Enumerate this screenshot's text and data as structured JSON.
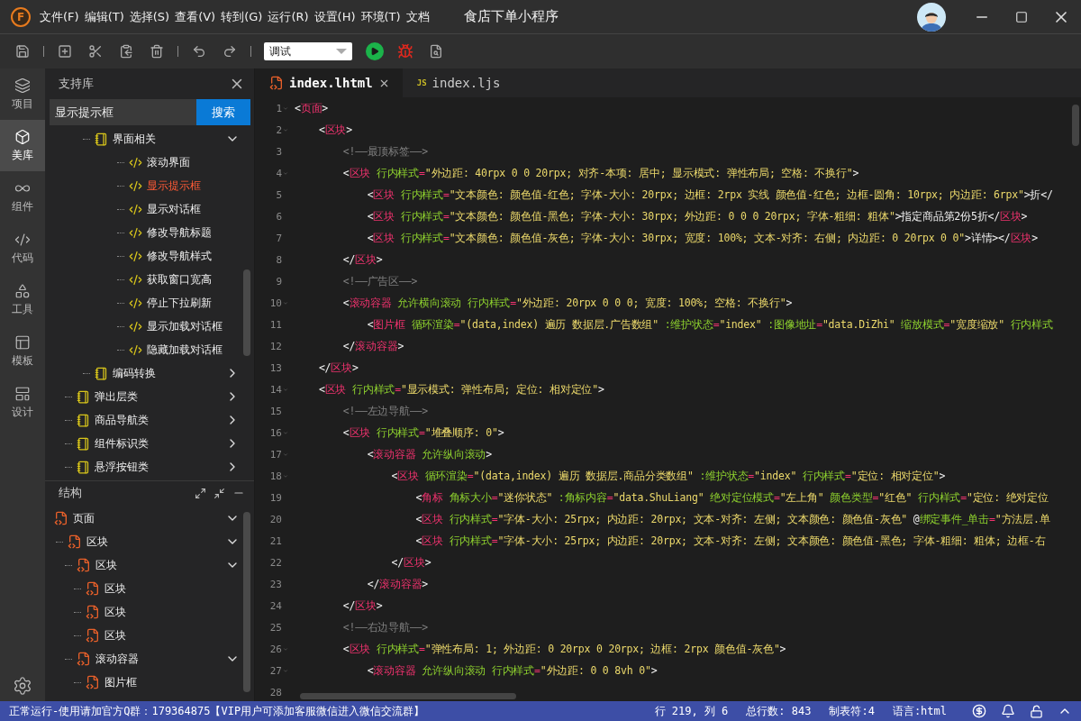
{
  "app": {
    "logo_letter": "F",
    "menu": [
      "文件(F)",
      "编辑(T)",
      "选择(S)",
      "查看(V)",
      "转到(G)",
      "运行(R)",
      "设置(H)",
      "环境(T)",
      "文档"
    ],
    "title": "食店下单小程序"
  },
  "toolbar": {
    "mode_select": {
      "value": "调试"
    }
  },
  "activity_bar": [
    {
      "label": "项目",
      "kind": "layers",
      "selected": false
    },
    {
      "label": "美库",
      "kind": "box",
      "selected": true
    },
    {
      "label": "组件",
      "kind": "links",
      "selected": false
    },
    {
      "label": "代码",
      "kind": "code",
      "selected": false
    },
    {
      "label": "工具",
      "kind": "tools",
      "selected": false
    },
    {
      "label": "模板",
      "kind": "template",
      "selected": false
    },
    {
      "label": "设计",
      "kind": "design",
      "selected": false
    }
  ],
  "library": {
    "title": "支持库",
    "search": {
      "value": "显示提示框"
    },
    "search_button": "搜索",
    "items": [
      {
        "kind": "group",
        "children": [
          {
            "label": "界面相关",
            "kind": "category",
            "expanded": true,
            "children": [
              {
                "label": "滚动界面",
                "kind": "snippet",
                "selected": false
              },
              {
                "label": "显示提示框",
                "kind": "snippet",
                "selected": true
              },
              {
                "label": "显示对话框",
                "kind": "snippet",
                "selected": false
              },
              {
                "label": "修改导航标题",
                "kind": "snippet",
                "selected": false
              },
              {
                "label": "修改导航样式",
                "kind": "snippet",
                "selected": false
              },
              {
                "label": "获取窗口宽高",
                "kind": "snippet",
                "selected": false
              },
              {
                "label": "停止下拉刷新",
                "kind": "snippet",
                "selected": false
              },
              {
                "label": "显示加载对话框",
                "kind": "snippet",
                "selected": false
              },
              {
                "label": "隐藏加载对话框",
                "kind": "snippet",
                "selected": false
              }
            ]
          },
          {
            "label": "编码转换",
            "kind": "category",
            "expanded": false
          }
        ]
      },
      {
        "label": "弹出层类",
        "kind": "category",
        "expanded": false
      },
      {
        "label": "商品导航类",
        "kind": "category",
        "expanded": false
      },
      {
        "label": "组件标识类",
        "kind": "category",
        "expanded": false
      },
      {
        "label": "悬浮按钮类",
        "kind": "category",
        "expanded": false
      }
    ]
  },
  "structure": {
    "title": "结构",
    "items": [
      {
        "label": "页面",
        "expanded": true,
        "children": [
          {
            "label": "区块",
            "expanded": true,
            "children": [
              {
                "label": "区块",
                "expanded": true,
                "children": [
                  {
                    "label": "区块"
                  },
                  {
                    "label": "区块"
                  },
                  {
                    "label": "区块"
                  }
                ]
              },
              {
                "label": "滚动容器",
                "expanded": true,
                "children": [
                  {
                    "label": "图片框"
                  }
                ]
              }
            ]
          }
        ]
      }
    ]
  },
  "editor": {
    "tabs": [
      {
        "label": "index.lhtml",
        "kind": "html",
        "selected": true
      },
      {
        "label": "index.ljs",
        "kind": "js",
        "badge": "JS",
        "selected": false
      }
    ],
    "lines": [
      {
        "number": "1",
        "foldable": true,
        "tokens": [
          {
            "kind": "punct",
            "text": "<"
          },
          {
            "kind": "tag",
            "text": "页面"
          },
          {
            "kind": "punct",
            "text": ">"
          }
        ]
      },
      {
        "number": "2",
        "foldable": true,
        "tokens": [
          {
            "kind": "punct",
            "text": "    <"
          },
          {
            "kind": "tag",
            "text": "区块"
          },
          {
            "kind": "punct",
            "text": ">"
          }
        ]
      },
      {
        "number": "3",
        "foldable": false,
        "tokens": [
          {
            "kind": "comment",
            "text": "        <!——最顶标签——>"
          }
        ]
      },
      {
        "number": "4",
        "foldable": true,
        "tokens": [
          {
            "kind": "punct",
            "text": "        <"
          },
          {
            "kind": "tag",
            "text": "区块"
          },
          {
            "kind": "attr",
            "text": " 行内样式"
          },
          {
            "kind": "op",
            "text": "="
          },
          {
            "kind": "string",
            "text": "\"外边距: 40rpx 0 0 20rpx; 对齐-本项: 居中; 显示模式: 弹性布局; 空格: 不换行\""
          },
          {
            "kind": "punct",
            "text": ">"
          }
        ]
      },
      {
        "number": "5",
        "foldable": false,
        "tokens": [
          {
            "kind": "punct",
            "text": "            <"
          },
          {
            "kind": "tag",
            "text": "区块"
          },
          {
            "kind": "attr",
            "text": " 行内样式"
          },
          {
            "kind": "op",
            "text": "="
          },
          {
            "kind": "string",
            "text": "\"文本颜色: 颜色值-红色; 字体-大小: 20rpx; 边框: 2rpx 实线 颜色值-红色; 边框-圆角: 10rpx; 内边距: 6rpx\""
          },
          {
            "kind": "punct",
            "text": ">折</"
          }
        ]
      },
      {
        "number": "6",
        "foldable": false,
        "tokens": [
          {
            "kind": "punct",
            "text": "            <"
          },
          {
            "kind": "tag",
            "text": "区块"
          },
          {
            "kind": "attr",
            "text": " 行内样式"
          },
          {
            "kind": "op",
            "text": "="
          },
          {
            "kind": "string",
            "text": "\"文本颜色: 颜色值-黑色; 字体-大小: 30rpx; 外边距: 0 0 0 20rpx; 字体-粗细: 粗体\""
          },
          {
            "kind": "punct",
            "text": ">指定商品第2份5折</"
          },
          {
            "kind": "tag",
            "text": "区块"
          },
          {
            "kind": "punct",
            "text": ">"
          }
        ]
      },
      {
        "number": "7",
        "foldable": false,
        "tokens": [
          {
            "kind": "punct",
            "text": "            <"
          },
          {
            "kind": "tag",
            "text": "区块"
          },
          {
            "kind": "attr",
            "text": " 行内样式"
          },
          {
            "kind": "op",
            "text": "="
          },
          {
            "kind": "string",
            "text": "\"文本颜色: 颜色值-灰色; 字体-大小: 30rpx; 宽度: 100%; 文本-对齐: 右侧; 内边距: 0 20rpx 0 0\""
          },
          {
            "kind": "punct",
            "text": ">详情></"
          },
          {
            "kind": "tag",
            "text": "区块"
          },
          {
            "kind": "punct",
            "text": ">"
          }
        ]
      },
      {
        "number": "8",
        "foldable": false,
        "tokens": [
          {
            "kind": "punct",
            "text": "        </"
          },
          {
            "kind": "tag",
            "text": "区块"
          },
          {
            "kind": "punct",
            "text": ">"
          }
        ]
      },
      {
        "number": "9",
        "foldable": false,
        "tokens": [
          {
            "kind": "comment",
            "text": "        <!——广告区——>"
          }
        ]
      },
      {
        "number": "10",
        "foldable": true,
        "tokens": [
          {
            "kind": "punct",
            "text": "        <"
          },
          {
            "kind": "tag",
            "text": "滚动容器"
          },
          {
            "kind": "attr",
            "text": " 允许横向滚动 行内样式"
          },
          {
            "kind": "op",
            "text": "="
          },
          {
            "kind": "string",
            "text": "\"外边距: 20rpx 0 0 0; 宽度: 100%; 空格: 不换行\""
          },
          {
            "kind": "punct",
            "text": ">"
          }
        ]
      },
      {
        "number": "11",
        "foldable": false,
        "tokens": [
          {
            "kind": "punct",
            "text": "            <"
          },
          {
            "kind": "tag",
            "text": "图片框"
          },
          {
            "kind": "attr",
            "text": " 循环渲染"
          },
          {
            "kind": "op",
            "text": "="
          },
          {
            "kind": "string",
            "text": "\"(data,index) 遍历 数据层.广告数组\""
          },
          {
            "kind": "attr",
            "text": " :维护状态"
          },
          {
            "kind": "op",
            "text": "="
          },
          {
            "kind": "string",
            "text": "\"index\""
          },
          {
            "kind": "attr",
            "text": " :图像地址"
          },
          {
            "kind": "op",
            "text": "="
          },
          {
            "kind": "string",
            "text": "\"data.DiZhi\""
          },
          {
            "kind": "attr",
            "text": " 缩放模式"
          },
          {
            "kind": "op",
            "text": "="
          },
          {
            "kind": "string",
            "text": "\"宽度缩放\""
          },
          {
            "kind": "attr",
            "text": " 行内样式"
          }
        ]
      },
      {
        "number": "12",
        "foldable": false,
        "tokens": [
          {
            "kind": "punct",
            "text": "        </"
          },
          {
            "kind": "tag",
            "text": "滚动容器"
          },
          {
            "kind": "punct",
            "text": ">"
          }
        ]
      },
      {
        "number": "13",
        "foldable": false,
        "tokens": [
          {
            "kind": "punct",
            "text": "    </"
          },
          {
            "kind": "tag",
            "text": "区块"
          },
          {
            "kind": "punct",
            "text": ">"
          }
        ]
      },
      {
        "number": "14",
        "foldable": true,
        "tokens": [
          {
            "kind": "punct",
            "text": "    <"
          },
          {
            "kind": "tag",
            "text": "区块"
          },
          {
            "kind": "attr",
            "text": " 行内样式"
          },
          {
            "kind": "op",
            "text": "="
          },
          {
            "kind": "string",
            "text": "\"显示模式: 弹性布局; 定位: 相对定位\""
          },
          {
            "kind": "punct",
            "text": ">"
          }
        ]
      },
      {
        "number": "15",
        "foldable": false,
        "tokens": [
          {
            "kind": "comment",
            "text": "        <!——左边导航——>"
          }
        ]
      },
      {
        "number": "16",
        "foldable": true,
        "tokens": [
          {
            "kind": "punct",
            "text": "        <"
          },
          {
            "kind": "tag",
            "text": "区块"
          },
          {
            "kind": "attr",
            "text": " 行内样式"
          },
          {
            "kind": "op",
            "text": "="
          },
          {
            "kind": "string",
            "text": "\"堆叠顺序: 0\""
          },
          {
            "kind": "punct",
            "text": ">"
          }
        ]
      },
      {
        "number": "17",
        "foldable": true,
        "tokens": [
          {
            "kind": "punct",
            "text": "            <"
          },
          {
            "kind": "tag",
            "text": "滚动容器"
          },
          {
            "kind": "attr",
            "text": " 允许纵向滚动"
          },
          {
            "kind": "punct",
            "text": ">"
          }
        ]
      },
      {
        "number": "18",
        "foldable": true,
        "tokens": [
          {
            "kind": "punct",
            "text": "                <"
          },
          {
            "kind": "tag",
            "text": "区块"
          },
          {
            "kind": "attr",
            "text": " 循环渲染"
          },
          {
            "kind": "op",
            "text": "="
          },
          {
            "kind": "string",
            "text": "\"(data,index) 遍历 数据层.商品分类数组\""
          },
          {
            "kind": "attr",
            "text": " :维护状态"
          },
          {
            "kind": "op",
            "text": "="
          },
          {
            "kind": "string",
            "text": "\"index\""
          },
          {
            "kind": "attr",
            "text": " 行内样式"
          },
          {
            "kind": "op",
            "text": "="
          },
          {
            "kind": "string",
            "text": "\"定位: 相对定位\""
          },
          {
            "kind": "punct",
            "text": ">"
          }
        ]
      },
      {
        "number": "19",
        "foldable": false,
        "tokens": [
          {
            "kind": "punct",
            "text": "                    <"
          },
          {
            "kind": "tag",
            "text": "角标"
          },
          {
            "kind": "attr",
            "text": " 角标大小"
          },
          {
            "kind": "op",
            "text": "="
          },
          {
            "kind": "string",
            "text": "\"迷你状态\""
          },
          {
            "kind": "attr",
            "text": " :角标内容"
          },
          {
            "kind": "op",
            "text": "="
          },
          {
            "kind": "string",
            "text": "\"data.ShuLiang\""
          },
          {
            "kind": "attr",
            "text": " 绝对定位模式"
          },
          {
            "kind": "op",
            "text": "="
          },
          {
            "kind": "string",
            "text": "\"左上角\""
          },
          {
            "kind": "attr",
            "text": " 颜色类型"
          },
          {
            "kind": "op",
            "text": "="
          },
          {
            "kind": "string",
            "text": "\"红色\""
          },
          {
            "kind": "attr",
            "text": " 行内样式"
          },
          {
            "kind": "op",
            "text": "="
          },
          {
            "kind": "string",
            "text": "\"定位: 绝对定位"
          }
        ]
      },
      {
        "number": "20",
        "foldable": false,
        "tokens": [
          {
            "kind": "punct",
            "text": "                    <"
          },
          {
            "kind": "tag",
            "text": "区块"
          },
          {
            "kind": "attr",
            "text": " 行内样式"
          },
          {
            "kind": "op",
            "text": "="
          },
          {
            "kind": "string",
            "text": "\"字体-大小: 25rpx; 内边距: 20rpx; 文本-对齐: 左侧; 文本颜色: 颜色值-灰色\""
          },
          {
            "kind": "punct",
            "text": " @"
          },
          {
            "kind": "attr",
            "text": "绑定事件_单击"
          },
          {
            "kind": "op",
            "text": "="
          },
          {
            "kind": "string",
            "text": "\"方法层.单"
          }
        ]
      },
      {
        "number": "21",
        "foldable": false,
        "tokens": [
          {
            "kind": "punct",
            "text": "                    <"
          },
          {
            "kind": "tag",
            "text": "区块"
          },
          {
            "kind": "attr",
            "text": " 行内样式"
          },
          {
            "kind": "op",
            "text": "="
          },
          {
            "kind": "string",
            "text": "\"字体-大小: 25rpx; 内边距: 20rpx; 文本-对齐: 左侧; 文本颜色: 颜色值-黑色; 字体-粗细: 粗体; 边框-右"
          }
        ]
      },
      {
        "number": "22",
        "foldable": false,
        "tokens": [
          {
            "kind": "punct",
            "text": "                </"
          },
          {
            "kind": "tag",
            "text": "区块"
          },
          {
            "kind": "punct",
            "text": ">"
          }
        ]
      },
      {
        "number": "23",
        "foldable": false,
        "tokens": [
          {
            "kind": "punct",
            "text": "            </"
          },
          {
            "kind": "tag",
            "text": "滚动容器"
          },
          {
            "kind": "punct",
            "text": ">"
          }
        ]
      },
      {
        "number": "24",
        "foldable": false,
        "tokens": [
          {
            "kind": "punct",
            "text": "        </"
          },
          {
            "kind": "tag",
            "text": "区块"
          },
          {
            "kind": "punct",
            "text": ">"
          }
        ]
      },
      {
        "number": "25",
        "foldable": false,
        "tokens": [
          {
            "kind": "comment",
            "text": "        <!——右边导航——>"
          }
        ]
      },
      {
        "number": "26",
        "foldable": true,
        "tokens": [
          {
            "kind": "punct",
            "text": "        <"
          },
          {
            "kind": "tag",
            "text": "区块"
          },
          {
            "kind": "attr",
            "text": " 行内样式"
          },
          {
            "kind": "op",
            "text": "="
          },
          {
            "kind": "string",
            "text": "\"弹性布局: 1; 外边距: 0 20rpx 0 20rpx; 边框: 2rpx 颜色值-灰色\""
          },
          {
            "kind": "punct",
            "text": ">"
          }
        ]
      },
      {
        "number": "27",
        "foldable": true,
        "tokens": [
          {
            "kind": "punct",
            "text": "            <"
          },
          {
            "kind": "tag",
            "text": "滚动容器"
          },
          {
            "kind": "attr",
            "text": " 允许纵向滚动 行内样式"
          },
          {
            "kind": "op",
            "text": "="
          },
          {
            "kind": "string",
            "text": "\"外边距: 0 0 8vh 0\""
          },
          {
            "kind": "punct",
            "text": ">"
          }
        ]
      },
      {
        "number": "28",
        "foldable": false
      }
    ]
  },
  "status_bar": {
    "message": "正常运行-使用请加官方Q群：179364875【VIP用户可添加客服微信进入微信交流群】",
    "position": "行 219, 列 6",
    "total_lines": "总行数: 843",
    "tab_size": "制表符:4",
    "language": "语言:html"
  }
}
